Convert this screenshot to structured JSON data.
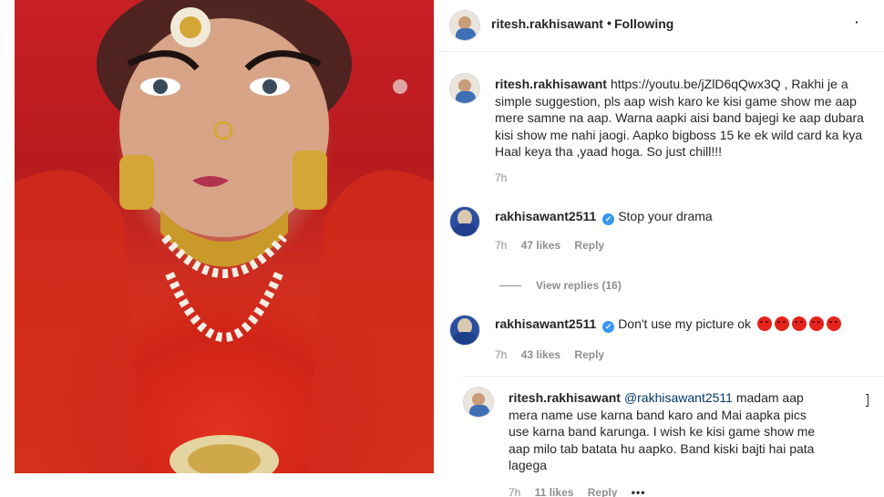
{
  "post": {
    "author": "ritesh.rakhisawant",
    "separator": "•",
    "follow_status": "Following",
    "more_glyph": "·"
  },
  "comments": [
    {
      "username": "ritesh.rakhisawant",
      "text": "https://youtu.be/jZlD6qQwx3Q , Rakhi je a simple suggestion, pls aap wish karo ke kisi game show me aap mere samne na aap. Warna aapki aisi band bajegi ke aap dubara kisi show me nahi jaogi. Aapko bigboss 15 ke ek wild card ka kya Haal keya tha ,yaad hoga. So just chill!!!",
      "time": "7h"
    },
    {
      "username": "rakhisawant2511",
      "verified": true,
      "text": "Stop your drama",
      "time": "7h",
      "likes": "47 likes",
      "reply": "Reply",
      "view_replies": "View replies (16)"
    },
    {
      "username": "rakhisawant2511",
      "verified": true,
      "text": "Don't use my picture ok",
      "emoji_count": 5,
      "emoji_name": "angry-face",
      "time": "7h",
      "likes": "43 likes",
      "reply": "Reply"
    }
  ],
  "reply": {
    "username": "ritesh.rakhisawant",
    "mention": "@rakhisawant2511",
    "text": "madam aap mera name use karna band karo and Mai aapka pics use karna band karunga. I wish ke kisi game show me aap milo tab batata hu aapko. Band kiski bajti hai pata lagega",
    "time": "7h",
    "likes": "11 likes",
    "reply_label": "Reply",
    "more_glyph": "•••"
  },
  "colors": {
    "mention": "#00376b",
    "secondary_text": "#8e8e8e",
    "verified_badge": "#3897f0",
    "photo_red": "#c81f24"
  }
}
